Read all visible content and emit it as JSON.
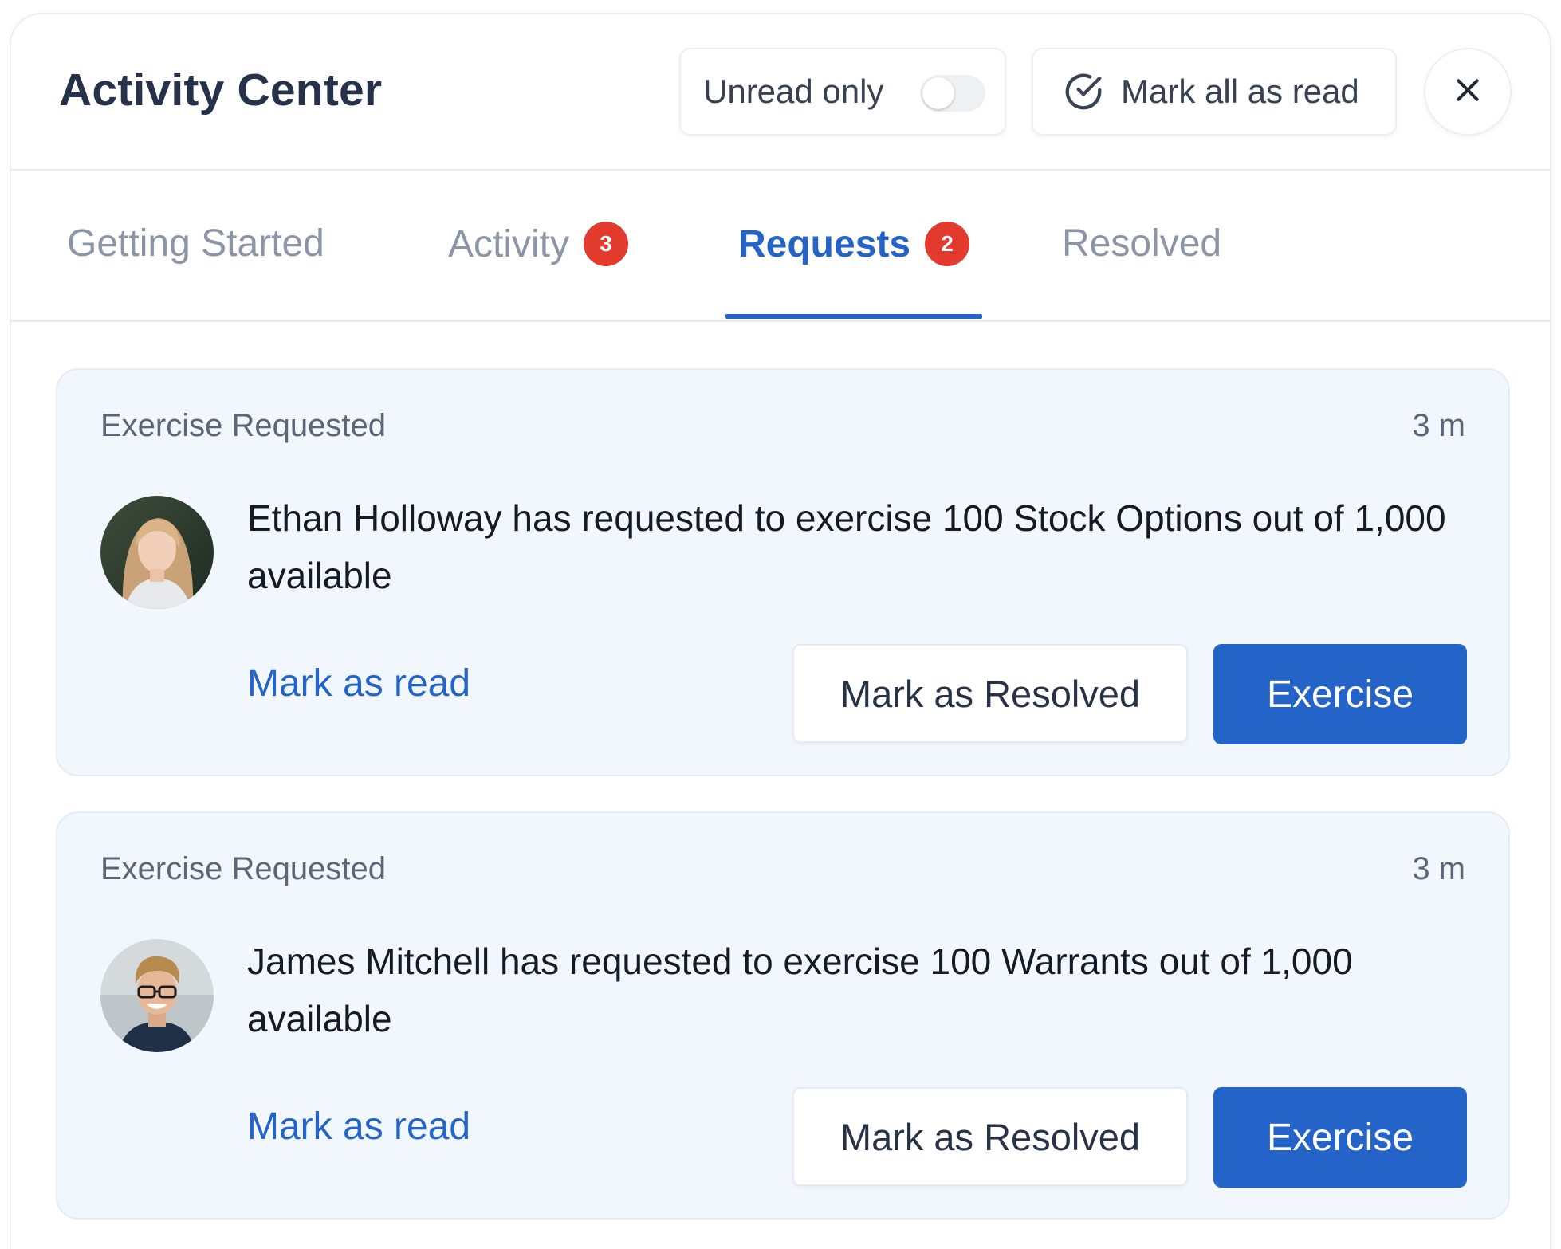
{
  "header": {
    "title": "Activity Center",
    "unread_only_label": "Unread only",
    "unread_only_enabled": false,
    "mark_all_label": "Mark all as read"
  },
  "tabs": [
    {
      "label": "Getting Started",
      "badge": null,
      "active": false
    },
    {
      "label": "Activity",
      "badge": "3",
      "active": false
    },
    {
      "label": "Requests",
      "badge": "2",
      "active": true
    },
    {
      "label": "Resolved",
      "badge": null,
      "active": false
    }
  ],
  "cards": [
    {
      "type": "Exercise Requested",
      "time": "3 m",
      "message": "Ethan Holloway has requested to exercise 100 Stock Options out of 1,000 available",
      "mark_read_label": "Mark as read",
      "resolve_label": "Mark as Resolved",
      "exercise_label": "Exercise"
    },
    {
      "type": "Exercise Requested",
      "time": "3 m",
      "message": "James Mitchell has requested to exercise 100 Warrants out of 1,000 available",
      "mark_read_label": "Mark as read",
      "resolve_label": "Mark as Resolved",
      "exercise_label": "Exercise"
    }
  ],
  "colors": {
    "accent": "#2463c7",
    "badge": "#e23b2e",
    "card_bg": "#f2f7fd"
  },
  "icons": {
    "mark_all": "check-circle-icon",
    "close": "close-icon"
  }
}
